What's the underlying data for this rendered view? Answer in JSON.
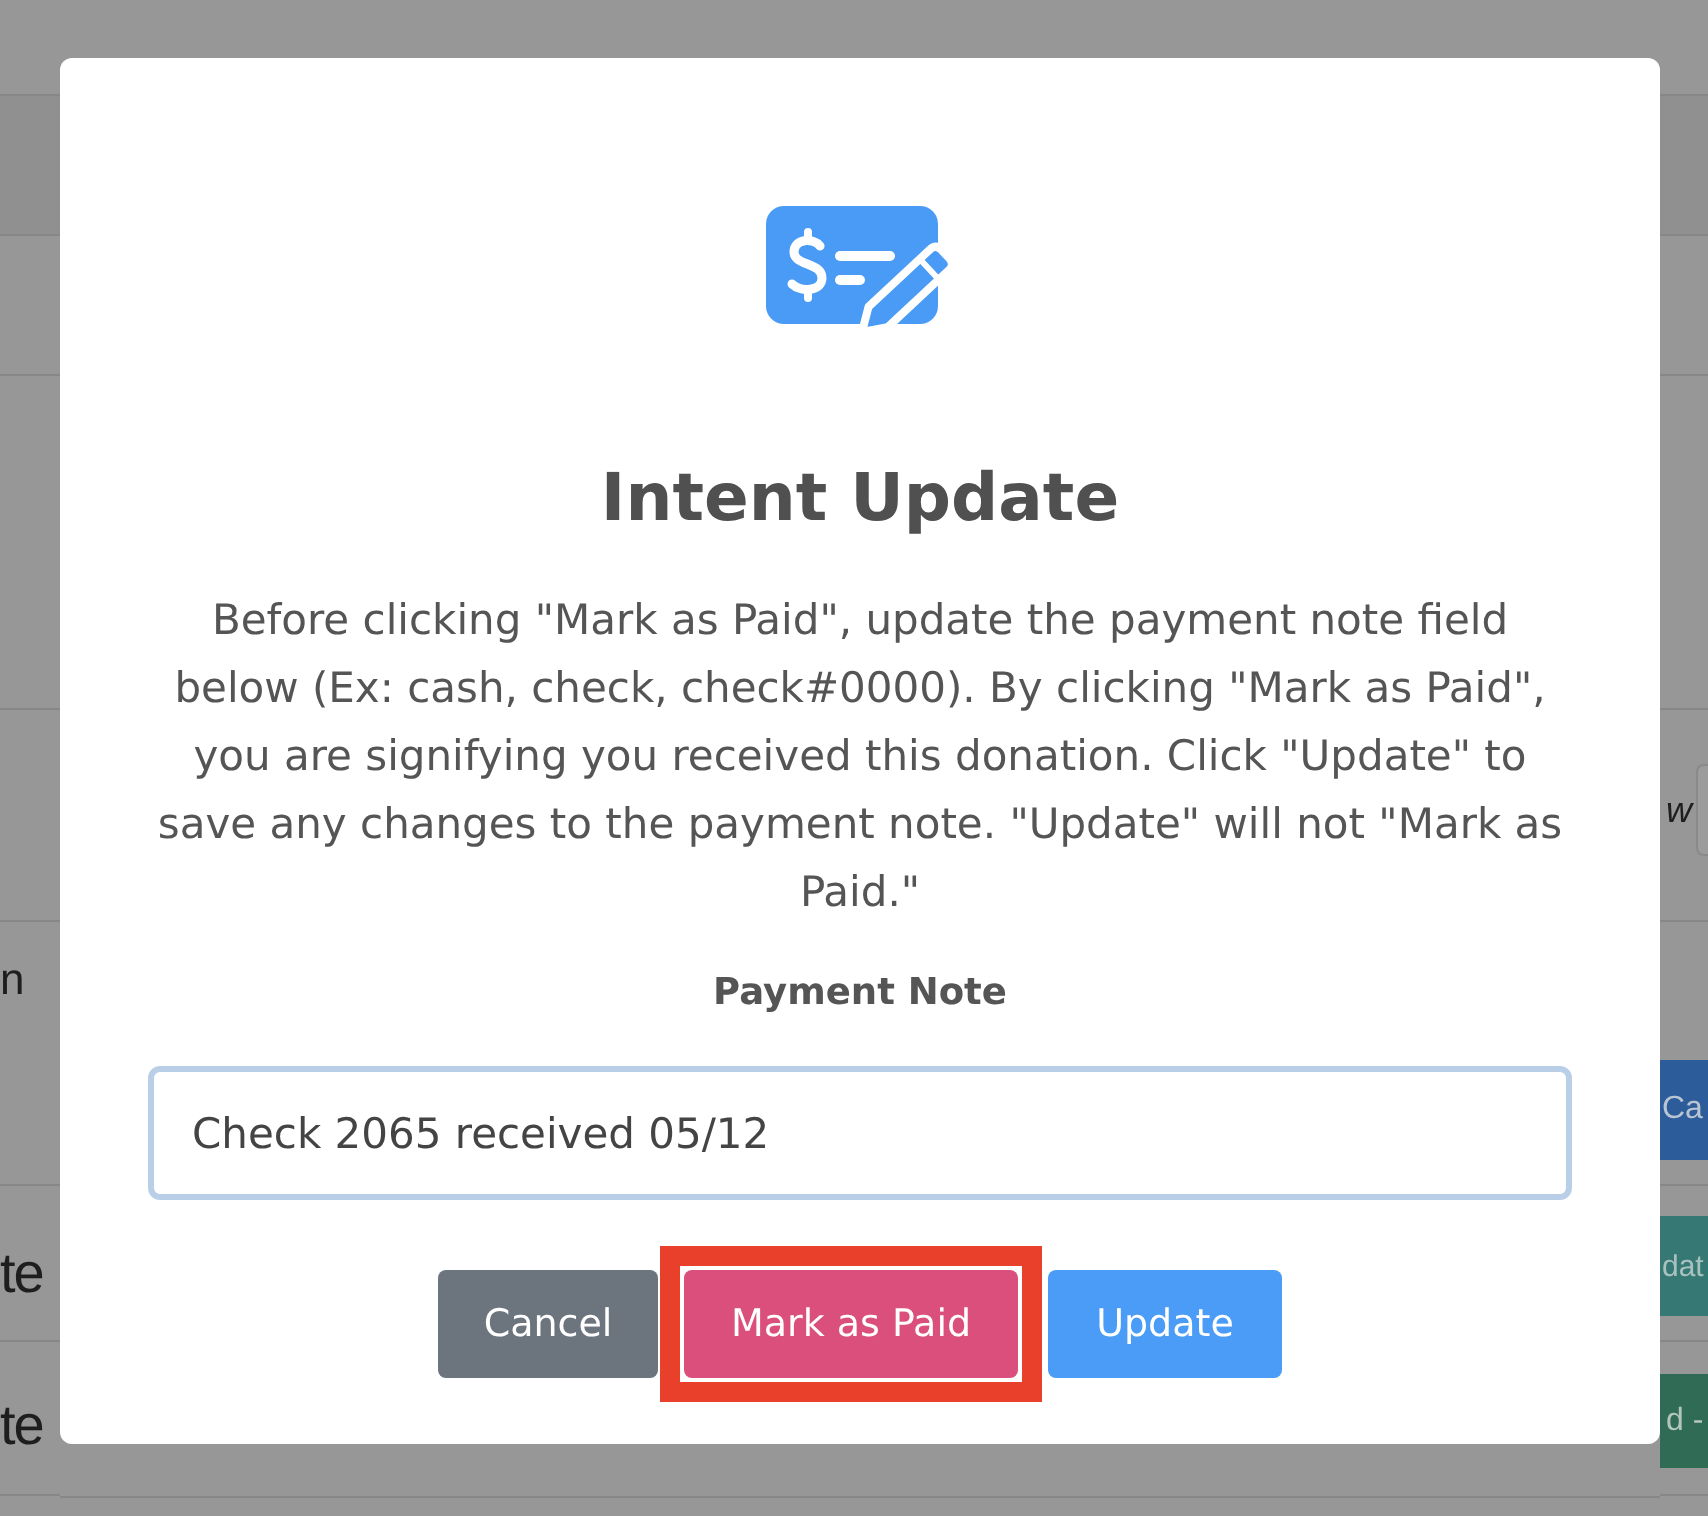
{
  "background": {
    "left_cells": [
      "n",
      "te",
      "te"
    ],
    "right": {
      "label": "w",
      "buttons": [
        {
          "label": "Ca",
          "kind": "primary"
        },
        {
          "label": "dat",
          "kind": "info"
        },
        {
          "label": "d -",
          "kind": "success"
        }
      ]
    }
  },
  "modal": {
    "title": "Intent Update",
    "message": "Before clicking \"Mark as Paid\", update the payment note field below (Ex: cash, check, check#0000). By clicking \"Mark as Paid\", you are signifying you received this donation. Click \"Update\" to save any changes to the payment note. \"Update\" will not \"Mark as Paid.\"",
    "payment_note": {
      "label": "Payment Note",
      "value": "Check 2065 received 05/12",
      "focused": true
    },
    "buttons": [
      {
        "label": "Cancel",
        "kind": "secondary",
        "highlighted": false
      },
      {
        "label": "Mark as Paid",
        "kind": "danger",
        "highlighted": true
      },
      {
        "label": "Update",
        "kind": "primary",
        "highlighted": false
      }
    ]
  }
}
